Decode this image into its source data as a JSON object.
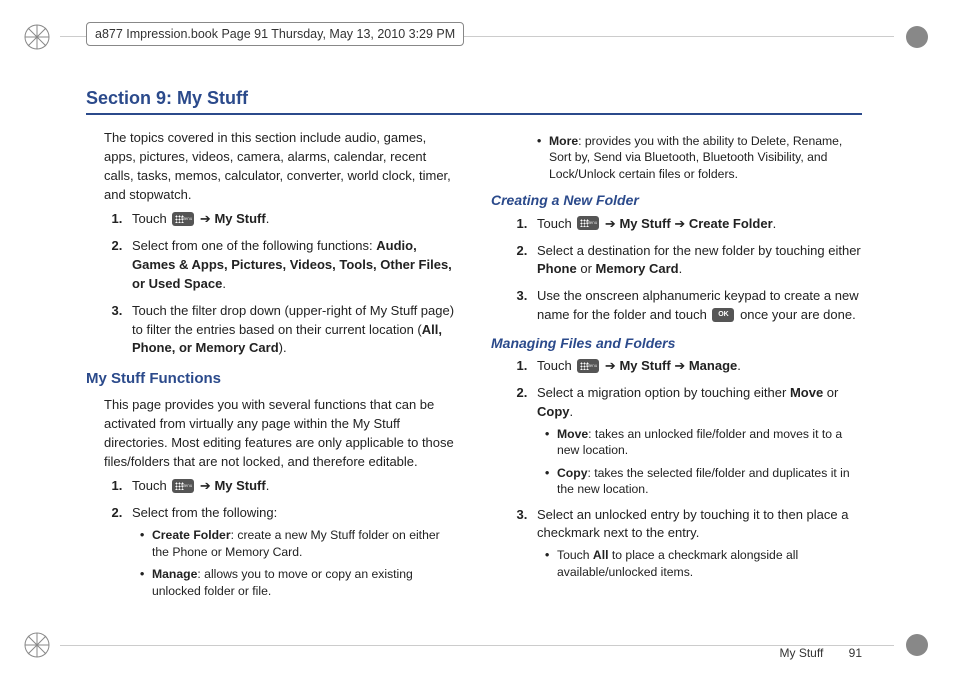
{
  "meta": {
    "header": "a877 Impression.book  Page 91  Thursday, May 13, 2010  3:29 PM"
  },
  "section": {
    "title": "Section 9: My Stuff"
  },
  "left": {
    "intro": "The topics covered in this section include audio, games, apps, pictures, videos, camera, alarms, calendar, recent calls, tasks, memos, calculator, converter, world clock, timer, and stopwatch.",
    "step1_a": "Touch ",
    "step1_b": " ➔ ",
    "step1_c": "My Stuff",
    "step1_d": ".",
    "step2_a": "Select from one of the following functions: ",
    "step2_opts": "Audio, Games & Apps, Pictures, Videos, Tools, Other Files, or Used Space",
    "step2_d": ".",
    "step3_a": "Touch the filter drop down (upper-right of My Stuff page) to filter the entries based on their current location (",
    "step3_opts": "All, Phone, or Memory Card",
    "step3_d": ").",
    "sub1": "My Stuff Functions",
    "func_intro": "This page provides you with several functions that can be activated from virtually any page within the My Stuff directories. Most editing features are only applicable to those files/folders that are not locked, and therefore editable.",
    "fstep1_a": "Touch ",
    "fstep1_b": " ➔ ",
    "fstep1_c": "My Stuff",
    "fstep1_d": ".",
    "fstep2": "Select from the following:",
    "bul_cf_t": "Create Folder",
    "bul_cf_d": ": create a new My Stuff folder on either the Phone or Memory Card.",
    "bul_mg_t": "Manage",
    "bul_mg_d": ": allows you to move or copy an existing unlocked folder or file."
  },
  "right": {
    "bul_more_t": "More",
    "bul_more_d": ": provides you with the ability to Delete, Rename, Sort by, Send via Bluetooth, Bluetooth Visibility, and Lock/Unlock certain files or folders.",
    "sub_create": "Creating a New Folder",
    "c1_a": "Touch ",
    "c1_b": " ➔ ",
    "c1_c": "My Stuff",
    "c1_d": " ➔ ",
    "c1_e": "Create Folder",
    "c1_f": ".",
    "c2_a": "Select a destination for the new folder by touching either ",
    "c2_b": "Phone",
    "c2_c": " or ",
    "c2_d": "Memory Card",
    "c2_e": ".",
    "c3_a": "Use the onscreen alphanumeric keypad to create a new name for the folder and touch ",
    "c3_ok": "OK",
    "c3_b": " once your are done.",
    "sub_manage": "Managing Files and Folders",
    "m1_a": "Touch ",
    "m1_b": " ➔ ",
    "m1_c": "My Stuff",
    "m1_d": " ➔ ",
    "m1_e": "Manage",
    "m1_f": ".",
    "m2_a": "Select a migration option by touching either ",
    "m2_b": "Move",
    "m2_c": " or ",
    "m2_d": "Copy",
    "m2_e": ".",
    "bul_mv_t": "Move",
    "bul_mv_d": ": takes an unlocked file/folder and moves it to a new location.",
    "bul_cp_t": "Copy",
    "bul_cp_d": ": takes the selected file/folder and duplicates it in the new location.",
    "m3": "Select an unlocked entry by touching it to then place a checkmark next to the entry.",
    "bul_all_a": "Touch ",
    "bul_all_b": "All",
    "bul_all_c": " to place a checkmark alongside all available/unlocked items."
  },
  "footer": {
    "label": "My Stuff",
    "page": "91"
  }
}
